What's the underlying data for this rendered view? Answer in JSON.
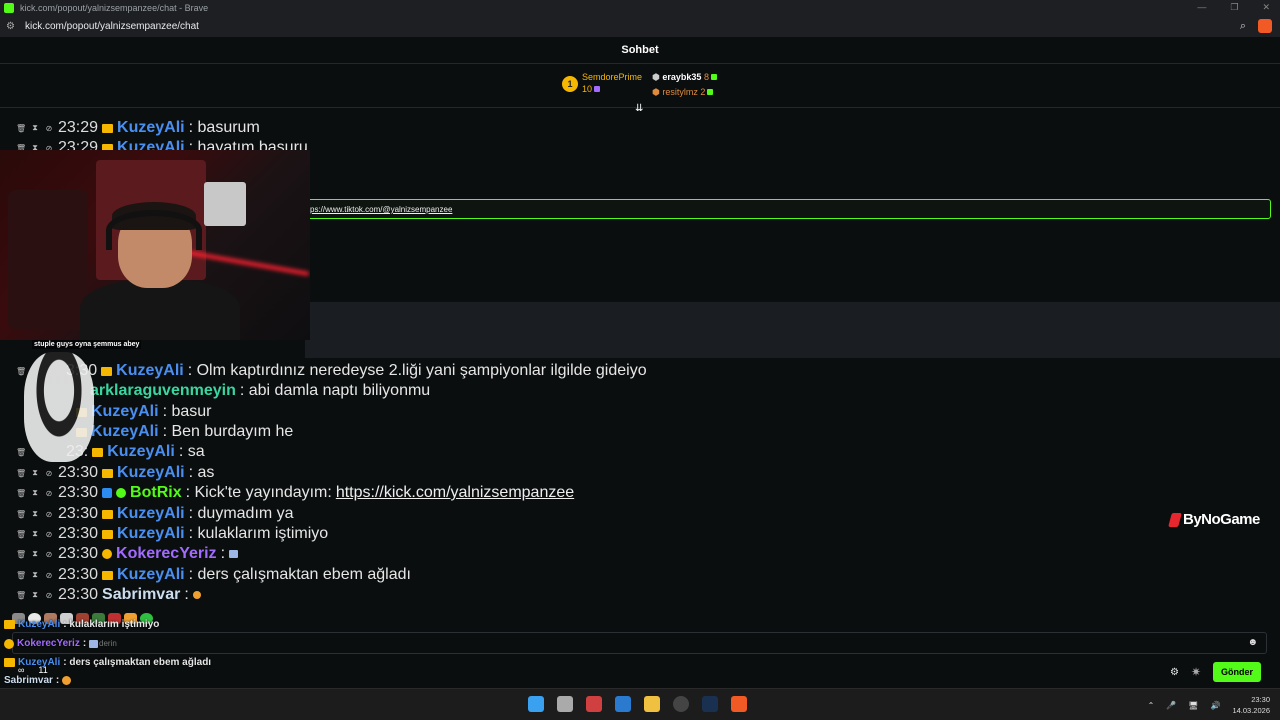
{
  "window": {
    "title": "kick.com/popout/yalnizsempanzee/chat - Brave"
  },
  "address": {
    "url": "kick.com/popout/yalnizsempanzee/chat"
  },
  "header": {
    "title": "Sohbet"
  },
  "leaderboard": {
    "first": {
      "rank": "1",
      "name": "SemdorePrime",
      "count": "10"
    },
    "second": {
      "name": "eraybk35",
      "count": "8"
    },
    "third": {
      "name": "resitylmz",
      "count": "2"
    }
  },
  "messages_top": [
    {
      "time": "23:29",
      "user": "KuzeyAli",
      "text": ": basurum"
    },
    {
      "time": "23:29",
      "user": "KuzeyAli",
      "text": ": hayatım basuru"
    }
  ],
  "highlight": {
    "link": "ps://www.tiktok.com/@yalnizsempanzee"
  },
  "messages": [
    {
      "time": "3:30",
      "user": "KuzeyAli",
      "text": ": Olm kaptırdınız neredeyse 2.liği yani şampiyonlar ilgilde gideiyo"
    },
    {
      "time": "",
      "user": "arklaraguvenmeyin",
      "text": ": abi damla naptı biliyonmu"
    },
    {
      "time": "",
      "user": "KuzeyAli",
      "text": ": basur"
    },
    {
      "time": "",
      "user": "KuzeyAli",
      "text": ": Ben burdayım he"
    },
    {
      "time": "23:",
      "user": "KuzeyAli",
      "text": ": sa"
    },
    {
      "time": "23:30",
      "user": "KuzeyAli",
      "text": ": as"
    },
    {
      "time": "23:30",
      "user": "BotRix",
      "text": ": Kick'te yayındayım: ",
      "link": "https://kick.com/yalnizsempanzee"
    },
    {
      "time": "23:30",
      "user": "KuzeyAli",
      "text": ": duymadım ya"
    },
    {
      "time": "23:30",
      "user": "KuzeyAli",
      "text": ": kulaklarım iştimiyo"
    },
    {
      "time": "23:30",
      "user": "KokerecYeriz",
      "text": ":"
    },
    {
      "time": "23:30",
      "user": "KuzeyAli",
      "text": ": ders çalışmaktan ebem ağladı"
    },
    {
      "time": "23:30",
      "user": "Sabrimvar",
      "text": ":"
    }
  ],
  "cat_caption": "stuple guys oyna şemmus abey",
  "overlay": [
    {
      "user": "KuzeyAli",
      "text": ": kulaklarım iştimiyo"
    },
    {
      "user": "KokerecYeriz",
      "text": ":"
    },
    {
      "user": "KuzeyAli",
      "text": ": ders çalışmaktan ebem ağladı"
    },
    {
      "user": "Sabrimvar",
      "text": ":"
    }
  ],
  "input": {
    "placeholder": "derin"
  },
  "stats": {
    "infinity": "∞",
    "count": "11"
  },
  "send_label": "Gönder",
  "watermark": "ByNoGame",
  "clock": {
    "time": "23:30",
    "date": "14.03.2026"
  },
  "colors": {
    "kick_green": "#53fc18",
    "gold": "#f5b700",
    "user_blue": "#4a8ff0"
  }
}
